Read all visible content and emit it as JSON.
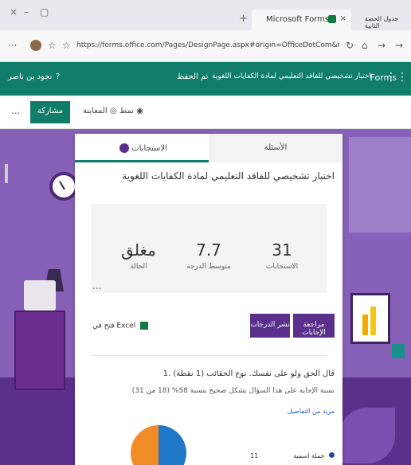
{
  "browser": {
    "active_tab": "Microsoft Forms",
    "other_tab": "جدول الحصة الثانية",
    "url": "https://forms.office.com/Pages/DesignPage.aspx#origin=OfficeDotCom&route=Start&lang=ar-SA#Analysis..."
  },
  "forms_header": {
    "brand": "Forms",
    "title": "اختبار تشخيصي للفاقد التعليمي لمادة الكفايات اللغوية",
    "saved": "تم الحفظ",
    "user": "نجود بن ناصر"
  },
  "command_bar": {
    "share": "مشاركة",
    "preview": "المعاينة",
    "style": "نمط",
    "more": "..."
  },
  "tabs": {
    "questions": "الأسئلة",
    "responses": "الاستجابات"
  },
  "form": {
    "title": "اختبار تشخيصي للفاقد التعليمي لمادة الكفايات اللغوية"
  },
  "stats": [
    {
      "value": "31",
      "label": "الاستجابات"
    },
    {
      "value": "7.7",
      "label": "متوسط الدرجة"
    },
    {
      "value": "مغلق",
      "label": "الحالة"
    }
  ],
  "actions": {
    "review": "مراجعة الإجابات",
    "post_scores": "نشر الدرجات",
    "excel": "فتح في Excel"
  },
  "question1": {
    "title": "1. قال الحق ولو على نفسك. نوع الحقائب (1 نقطة)",
    "stats": "نسبة الإجابة على هذا السؤال بشكل صحيح بنسبة 58% (18 من 31)",
    "details": "مزيد من التفاصيل",
    "legend_label": "جملة اسمية",
    "legend_count": "11"
  },
  "colors": {
    "forms_green": "#107c6a",
    "purple": "#5b2f8c",
    "stage": "#8761b8"
  }
}
